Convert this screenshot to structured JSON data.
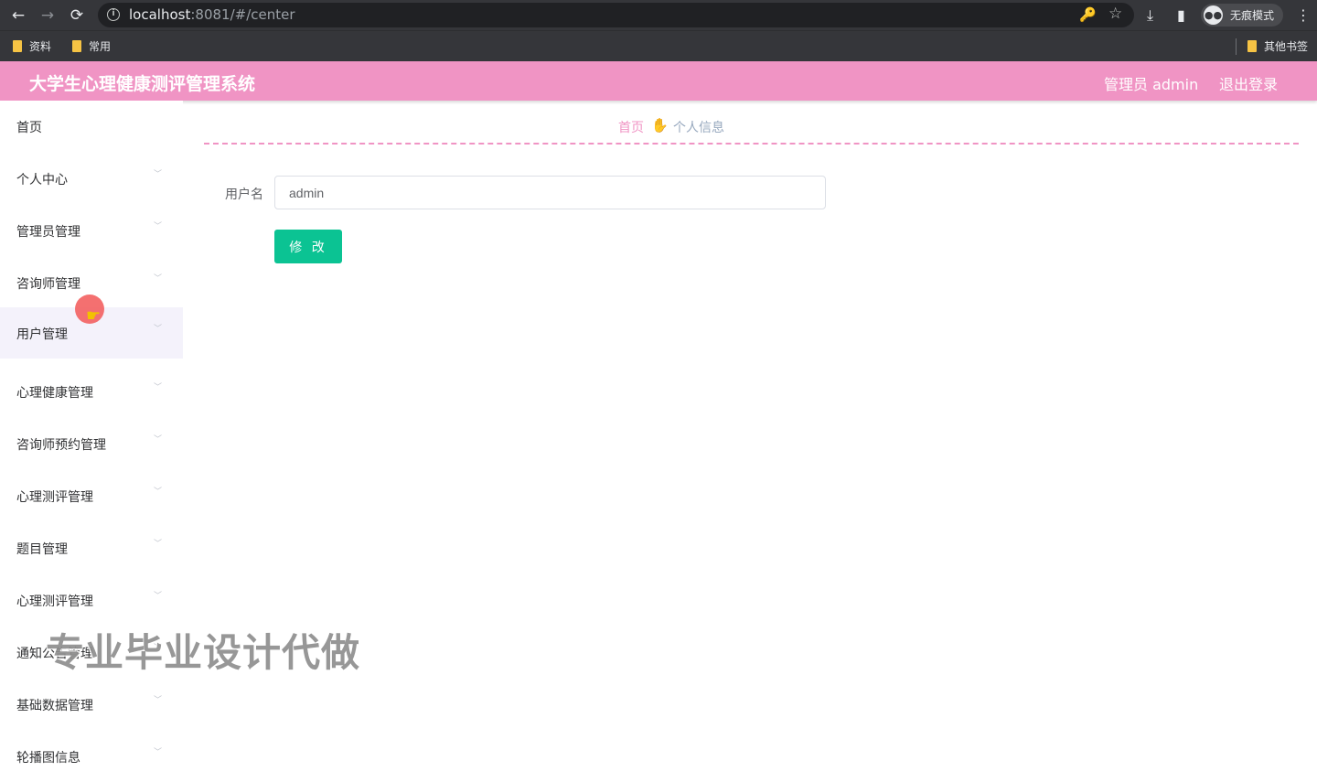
{
  "browser": {
    "url_host": "localhost",
    "url_rest": ":8081/#/center",
    "incognito_label": "无痕模式",
    "bookmarks": [
      "资料",
      "常用"
    ],
    "other_bookmarks": "其他书签",
    "icons": {
      "back": "←",
      "forward": "→",
      "reload": "⟳",
      "key": "🔑",
      "star": "☆",
      "download": "⤓",
      "side_panel": "▮",
      "menu": "⋮"
    }
  },
  "header": {
    "title": "大学生心理健康测评管理系统",
    "user": "管理员 admin",
    "logout": "退出登录",
    "color": "#f094c4"
  },
  "sidebar": {
    "items": [
      {
        "label": "首页",
        "has_arrow": false
      },
      {
        "label": "个人中心",
        "has_arrow": true
      },
      {
        "label": "管理员管理",
        "has_arrow": true
      },
      {
        "label": "咨询师管理",
        "has_arrow": true
      },
      {
        "label": "用户管理",
        "has_arrow": true
      },
      {
        "label": "心理健康管理",
        "has_arrow": true
      },
      {
        "label": "咨询师预约管理",
        "has_arrow": true
      },
      {
        "label": "心理测评管理",
        "has_arrow": true
      },
      {
        "label": "题目管理",
        "has_arrow": true
      },
      {
        "label": "心理测评管理",
        "has_arrow": true
      },
      {
        "label": "通知公告管理",
        "has_arrow": true
      },
      {
        "label": "基础数据管理",
        "has_arrow": true
      },
      {
        "label": "轮播图信息",
        "has_arrow": true
      }
    ],
    "hovered_item": "用户管理"
  },
  "breadcrumb": {
    "home": "首页",
    "separator_icon": "hand-icon",
    "current": "个人信息"
  },
  "form": {
    "username_label": "用户名",
    "username_value": "admin",
    "submit_label": "修 改",
    "submit_color": "#0bc393"
  },
  "watermark": "专业毕业设计代做"
}
